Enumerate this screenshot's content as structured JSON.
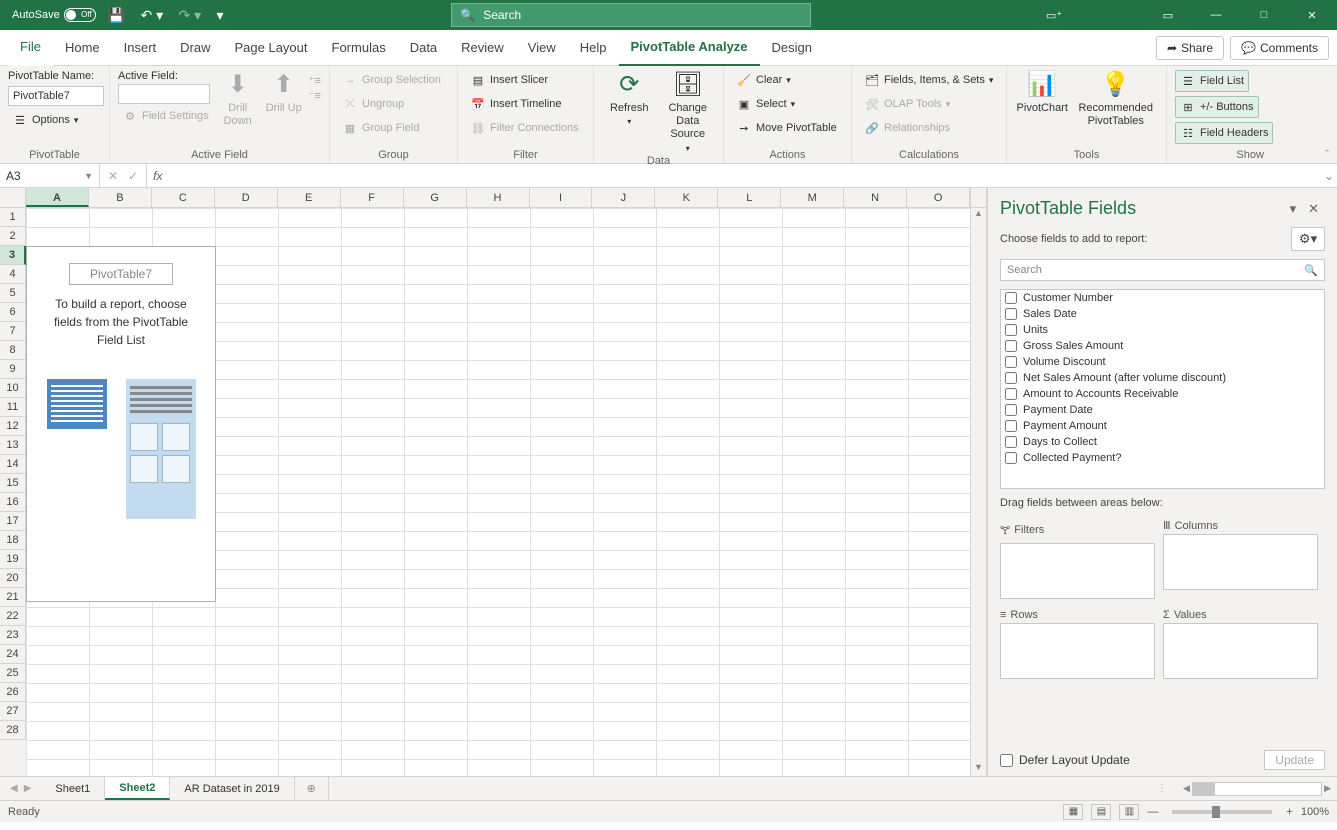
{
  "titlebar": {
    "autosave_label": "AutoSave",
    "autosave_state": "Off",
    "search_placeholder": "Search"
  },
  "tabs": {
    "file": "File",
    "home": "Home",
    "insert": "Insert",
    "draw": "Draw",
    "page_layout": "Page Layout",
    "formulas": "Formulas",
    "data": "Data",
    "review": "Review",
    "view": "View",
    "help": "Help",
    "pt_analyze": "PivotTable Analyze",
    "design": "Design",
    "share": "Share",
    "comments": "Comments"
  },
  "ribbon": {
    "pivottable": {
      "name_lbl": "PivotTable Name:",
      "name_val": "PivotTable7",
      "options": "Options",
      "group": "PivotTable"
    },
    "active_field": {
      "lbl": "Active Field:",
      "drill_down": "Drill Down",
      "drill_up": "Drill Up",
      "field_settings": "Field Settings",
      "group": "Active Field"
    },
    "group": {
      "selection": "Group Selection",
      "ungroup": "Ungroup",
      "field": "Group Field",
      "group": "Group"
    },
    "filter": {
      "slicer": "Insert Slicer",
      "timeline": "Insert Timeline",
      "conn": "Filter Connections",
      "group": "Filter"
    },
    "data": {
      "refresh": "Refresh",
      "change": "Change Data Source",
      "group": "Data"
    },
    "actions": {
      "clear": "Clear",
      "select": "Select",
      "move": "Move PivotTable",
      "group": "Actions"
    },
    "calc": {
      "fields": "Fields, Items, & Sets",
      "olap": "OLAP Tools",
      "rel": "Relationships",
      "group": "Calculations"
    },
    "tools": {
      "chart": "PivotChart",
      "rec": "Recommended PivotTables",
      "group": "Tools"
    },
    "show": {
      "list": "Field List",
      "buttons": "+/- Buttons",
      "headers": "Field Headers",
      "group": "Show"
    }
  },
  "name_box": "A3",
  "columns": [
    "A",
    "B",
    "C",
    "D",
    "E",
    "F",
    "G",
    "H",
    "I",
    "J",
    "K",
    "L",
    "M",
    "N",
    "O"
  ],
  "rows": [
    1,
    2,
    3,
    4,
    5,
    6,
    7,
    8,
    9,
    10,
    11,
    12,
    13,
    14,
    15,
    16,
    17,
    18,
    19,
    20,
    21,
    22,
    23,
    24,
    25,
    26,
    27,
    28
  ],
  "selected_col": "A",
  "selected_row": 3,
  "placeholder": {
    "name": "PivotTable7",
    "hint": "To build a report, choose fields from the PivotTable Field List"
  },
  "pane": {
    "title": "PivotTable Fields",
    "sub": "Choose fields to add to report:",
    "search": "Search",
    "fields": [
      "Customer Number",
      "Sales Date",
      "Units",
      "Gross Sales Amount",
      "Volume Discount",
      "Net Sales Amount (after volume discount)",
      "Amount to Accounts Receivable",
      "Payment Date",
      "Payment Amount",
      "Days to Collect",
      "Collected Payment?"
    ],
    "drag_lbl": "Drag fields between areas below:",
    "areas": {
      "filters": "Filters",
      "columns": "Columns",
      "rows": "Rows",
      "values": "Values"
    },
    "defer": "Defer Layout Update",
    "update": "Update"
  },
  "sheet_tabs": {
    "s1": "Sheet1",
    "s2": "Sheet2",
    "s3": "AR Dataset in 2019"
  },
  "status": {
    "ready": "Ready",
    "zoom": "100%"
  }
}
